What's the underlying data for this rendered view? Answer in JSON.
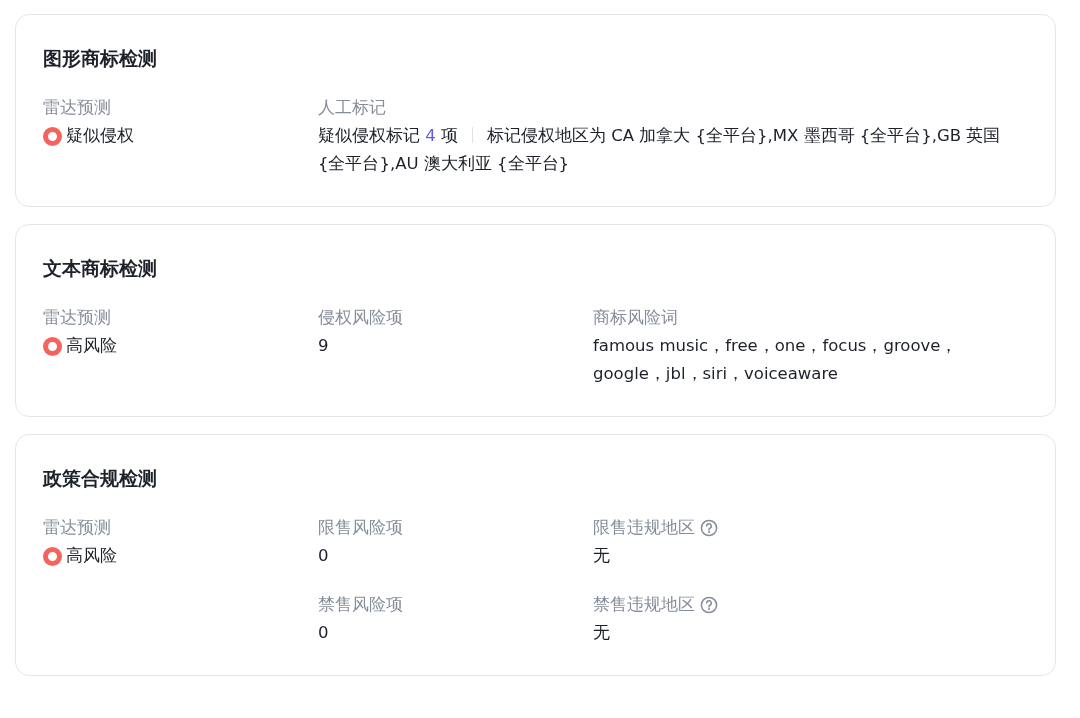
{
  "cards": [
    {
      "title": "图形商标检测",
      "columns": [
        [
          {
            "kind": "risk",
            "label": "雷达预测",
            "value": "疑似侵权",
            "help": false
          }
        ],
        [
          {
            "kind": "mark",
            "label": "人工标记",
            "value": "疑似侵权标记",
            "count": "4",
            "unit": "项",
            "detail": "标记侵权地区为 CA 加拿大 {全平台},MX 墨西哥 {全平台},GB 英国 {全平台},AU 澳大利亚 {全平台}",
            "help": false
          }
        ]
      ]
    },
    {
      "title": "文本商标检测",
      "columns": [
        [
          {
            "kind": "risk",
            "label": "雷达预测",
            "value": "高风险",
            "help": false
          }
        ],
        [
          {
            "kind": "text",
            "label": "侵权风险项",
            "value": "9",
            "help": false
          }
        ],
        [
          {
            "kind": "text",
            "label": "商标风险词",
            "value": "famous music，free，one，focus，groove，google，jbl，siri，voiceaware",
            "help": false
          }
        ]
      ]
    },
    {
      "title": "政策合规检测",
      "columns": [
        [
          {
            "kind": "risk",
            "label": "雷达预测",
            "value": "高风险",
            "help": false
          }
        ],
        [
          {
            "kind": "text",
            "label": "限售风险项",
            "value": "0",
            "help": false
          },
          {
            "kind": "text",
            "label": "禁售风险项",
            "value": "0",
            "help": false
          }
        ],
        [
          {
            "kind": "text",
            "label": "限售违规地区",
            "value": "无",
            "help": true
          },
          {
            "kind": "text",
            "label": "禁售违规地区",
            "value": "无",
            "help": true
          }
        ]
      ]
    }
  ]
}
